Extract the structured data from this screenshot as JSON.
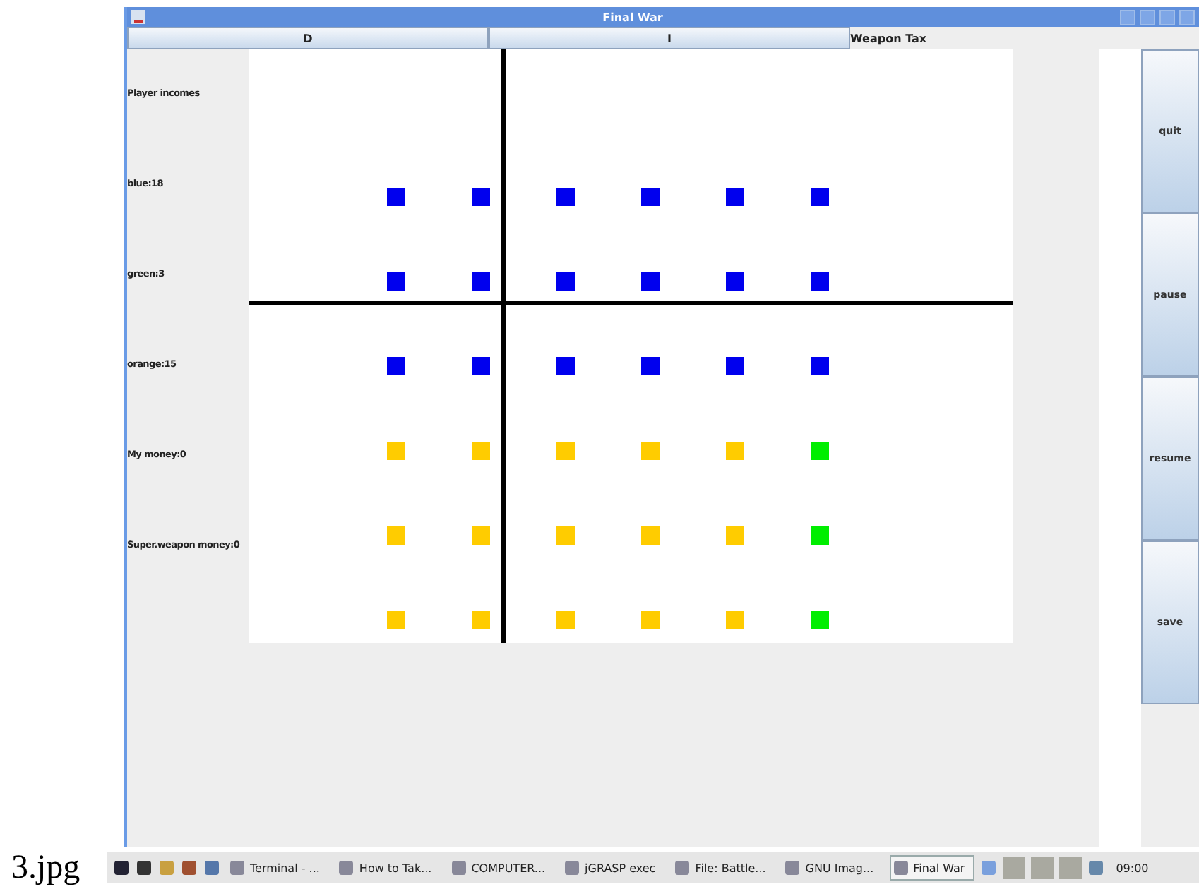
{
  "caption": "3.jpg",
  "window": {
    "title": "Final War"
  },
  "tabs": [
    {
      "label": "D"
    },
    {
      "label": "I"
    }
  ],
  "weapon_tax_label": "Weapon Tax",
  "incomes": [
    "Player incomes",
    "blue:18",
    "green:3",
    "orange:15",
    "My money:0",
    "Super.weapon money:0"
  ],
  "board": {
    "rows": [
      {
        "units": [
          {
            "color": "#0000ee"
          },
          {
            "color": "#0000ee"
          },
          {
            "color": "#0000ee"
          },
          {
            "color": "#0000ee"
          },
          {
            "color": "#0000ee"
          },
          {
            "color": "#0000ee"
          }
        ]
      },
      {
        "units": [
          {
            "color": "#0000ee"
          },
          {
            "color": "#0000ee"
          },
          {
            "color": "#0000ee"
          },
          {
            "color": "#0000ee"
          },
          {
            "color": "#0000ee"
          },
          {
            "color": "#0000ee"
          }
        ]
      },
      {
        "units": [
          {
            "color": "#0000ee"
          },
          {
            "color": "#0000ee"
          },
          {
            "color": "#0000ee"
          },
          {
            "color": "#0000ee"
          },
          {
            "color": "#0000ee"
          },
          {
            "color": "#0000ee"
          }
        ]
      },
      {
        "units": [
          {
            "color": "#ffcc00"
          },
          {
            "color": "#ffcc00"
          },
          {
            "color": "#ffcc00"
          },
          {
            "color": "#ffcc00"
          },
          {
            "color": "#ffcc00"
          },
          {
            "color": "#00ee00"
          }
        ]
      },
      {
        "units": [
          {
            "color": "#ffcc00"
          },
          {
            "color": "#ffcc00"
          },
          {
            "color": "#ffcc00"
          },
          {
            "color": "#ffcc00"
          },
          {
            "color": "#ffcc00"
          },
          {
            "color": "#00ee00"
          }
        ]
      },
      {
        "units": [
          {
            "color": "#ffcc00"
          },
          {
            "color": "#ffcc00"
          },
          {
            "color": "#ffcc00"
          },
          {
            "color": "#ffcc00"
          },
          {
            "color": "#ffcc00"
          },
          {
            "color": "#00ee00"
          }
        ]
      }
    ]
  },
  "buttons": [
    "quit",
    "pause",
    "resume",
    "save"
  ],
  "taskbar": {
    "tasks": [
      {
        "label": "Terminal - ...",
        "selected": false
      },
      {
        "label": "How to Tak...",
        "selected": false
      },
      {
        "label": "COMPUTER...",
        "selected": false
      },
      {
        "label": "jGRASP exec",
        "selected": false
      },
      {
        "label": "File: Battle...",
        "selected": false
      },
      {
        "label": "GNU Imag...",
        "selected": false
      },
      {
        "label": "Final War",
        "selected": true
      }
    ],
    "clock": "09:00"
  }
}
